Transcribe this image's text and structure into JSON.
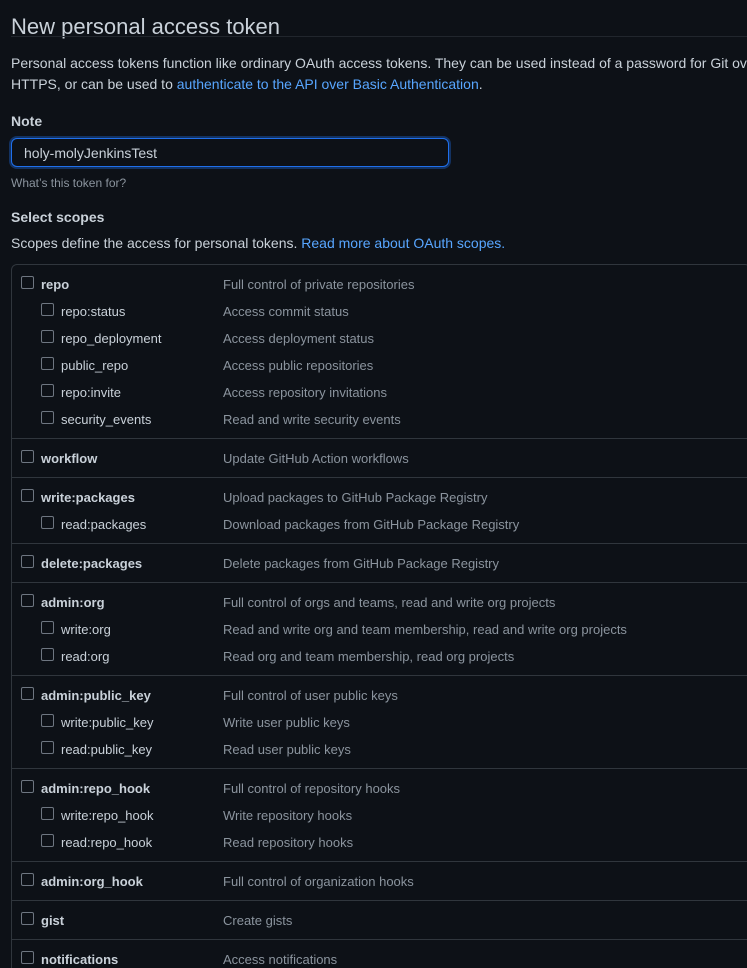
{
  "page": {
    "title": "New personal access token",
    "intro_text": "Personal access tokens function like ordinary OAuth access tokens. They can be used instead of a password for Git over HTTPS, or can be used to ",
    "intro_link": "authenticate to the API over Basic Authentication",
    "intro_end": "."
  },
  "note": {
    "label": "Note",
    "value": "holy-molyJenkinsTest",
    "hint": "What’s this token for?"
  },
  "scopes": {
    "label": "Select scopes",
    "description": "Scopes define the access for personal tokens. ",
    "link": "Read more about OAuth scopes.",
    "groups": [
      {
        "name": "repo",
        "desc": "Full control of private repositories",
        "children": [
          {
            "name": "repo:status",
            "desc": "Access commit status"
          },
          {
            "name": "repo_deployment",
            "desc": "Access deployment status"
          },
          {
            "name": "public_repo",
            "desc": "Access public repositories"
          },
          {
            "name": "repo:invite",
            "desc": "Access repository invitations"
          },
          {
            "name": "security_events",
            "desc": "Read and write security events"
          }
        ]
      },
      {
        "name": "workflow",
        "desc": "Update GitHub Action workflows",
        "children": []
      },
      {
        "name": "write:packages",
        "desc": "Upload packages to GitHub Package Registry",
        "children": [
          {
            "name": "read:packages",
            "desc": "Download packages from GitHub Package Registry"
          }
        ]
      },
      {
        "name": "delete:packages",
        "desc": "Delete packages from GitHub Package Registry",
        "children": []
      },
      {
        "name": "admin:org",
        "desc": "Full control of orgs and teams, read and write org projects",
        "children": [
          {
            "name": "write:org",
            "desc": "Read and write org and team membership, read and write org projects"
          },
          {
            "name": "read:org",
            "desc": "Read org and team membership, read org projects"
          }
        ]
      },
      {
        "name": "admin:public_key",
        "desc": "Full control of user public keys",
        "children": [
          {
            "name": "write:public_key",
            "desc": "Write user public keys"
          },
          {
            "name": "read:public_key",
            "desc": "Read user public keys"
          }
        ]
      },
      {
        "name": "admin:repo_hook",
        "desc": "Full control of repository hooks",
        "children": [
          {
            "name": "write:repo_hook",
            "desc": "Write repository hooks"
          },
          {
            "name": "read:repo_hook",
            "desc": "Read repository hooks"
          }
        ]
      },
      {
        "name": "admin:org_hook",
        "desc": "Full control of organization hooks",
        "children": []
      },
      {
        "name": "gist",
        "desc": "Create gists",
        "children": []
      },
      {
        "name": "notifications",
        "desc": "Access notifications",
        "children": []
      }
    ]
  },
  "colors": {
    "background": "#0d1117",
    "text": "#c9d1d9",
    "muted": "#8b949e",
    "link": "#58a6ff",
    "border": "#30363d",
    "focus": "#1f6feb"
  }
}
